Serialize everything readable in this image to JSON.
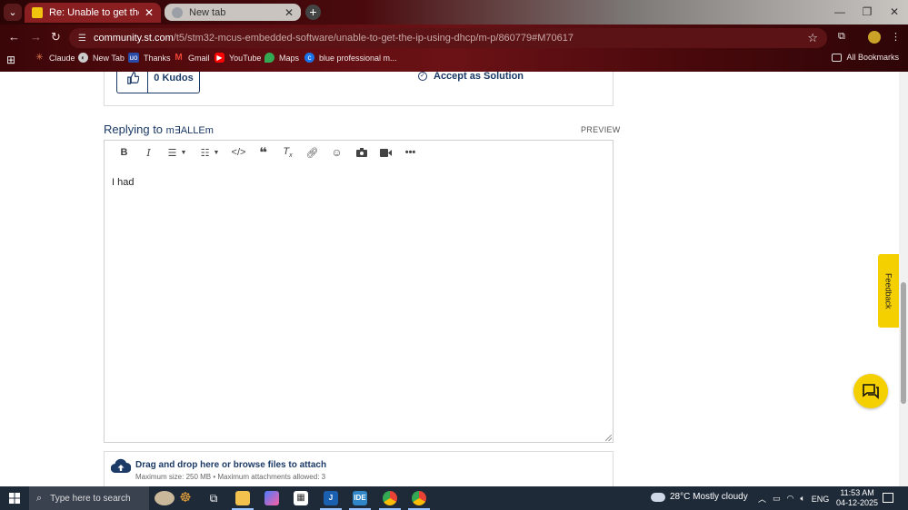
{
  "browser": {
    "tabs": [
      {
        "title": "Re: Unable to get the IP using D",
        "active": true
      },
      {
        "title": "New tab",
        "active": false
      }
    ],
    "new_tab_symbol": "+",
    "address": {
      "host": "community.st.com",
      "path": "/t5/stm32-mcus-embedded-software/unable-to-get-the-ip-using-dhcp/m-p/860779#M70617"
    },
    "bookmarks": [
      {
        "label": "Claude",
        "icon": "claude-icon"
      },
      {
        "label": "New Tab",
        "icon": "globe-icon"
      },
      {
        "label": "Thanks",
        "icon": "thanks-icon"
      },
      {
        "label": "Gmail",
        "icon": "gmail-icon"
      },
      {
        "label": "YouTube",
        "icon": "youtube-icon"
      },
      {
        "label": "Maps",
        "icon": "maps-icon"
      },
      {
        "label": "blue professional m...",
        "icon": "edge-icon"
      }
    ],
    "all_bookmarks": "All Bookmarks"
  },
  "post": {
    "kudos_label": "0 Kudos",
    "accept_label": "Accept as Solution"
  },
  "reply": {
    "heading": "Replying to",
    "user": "m∃ALLEm",
    "preview_label": "PREVIEW",
    "body_text": "I had"
  },
  "attachments": {
    "prefix": "Drag and drop here or ",
    "link": "browse",
    "suffix": " files to attach",
    "limits": "Maximum size: 250 MB • Maximum attachments allowed: 3"
  },
  "feedback_label": "Feedback",
  "taskbar": {
    "search_placeholder": "Type here to search",
    "weather": "28°C  Mostly cloudy",
    "language": "ENG",
    "time": "11:53 AM",
    "date": "04-12-2025"
  },
  "colors": {
    "brand_navy": "#1b3a66",
    "accent_yellow": "#f5d000",
    "chrome_red": "#5a0c10"
  }
}
